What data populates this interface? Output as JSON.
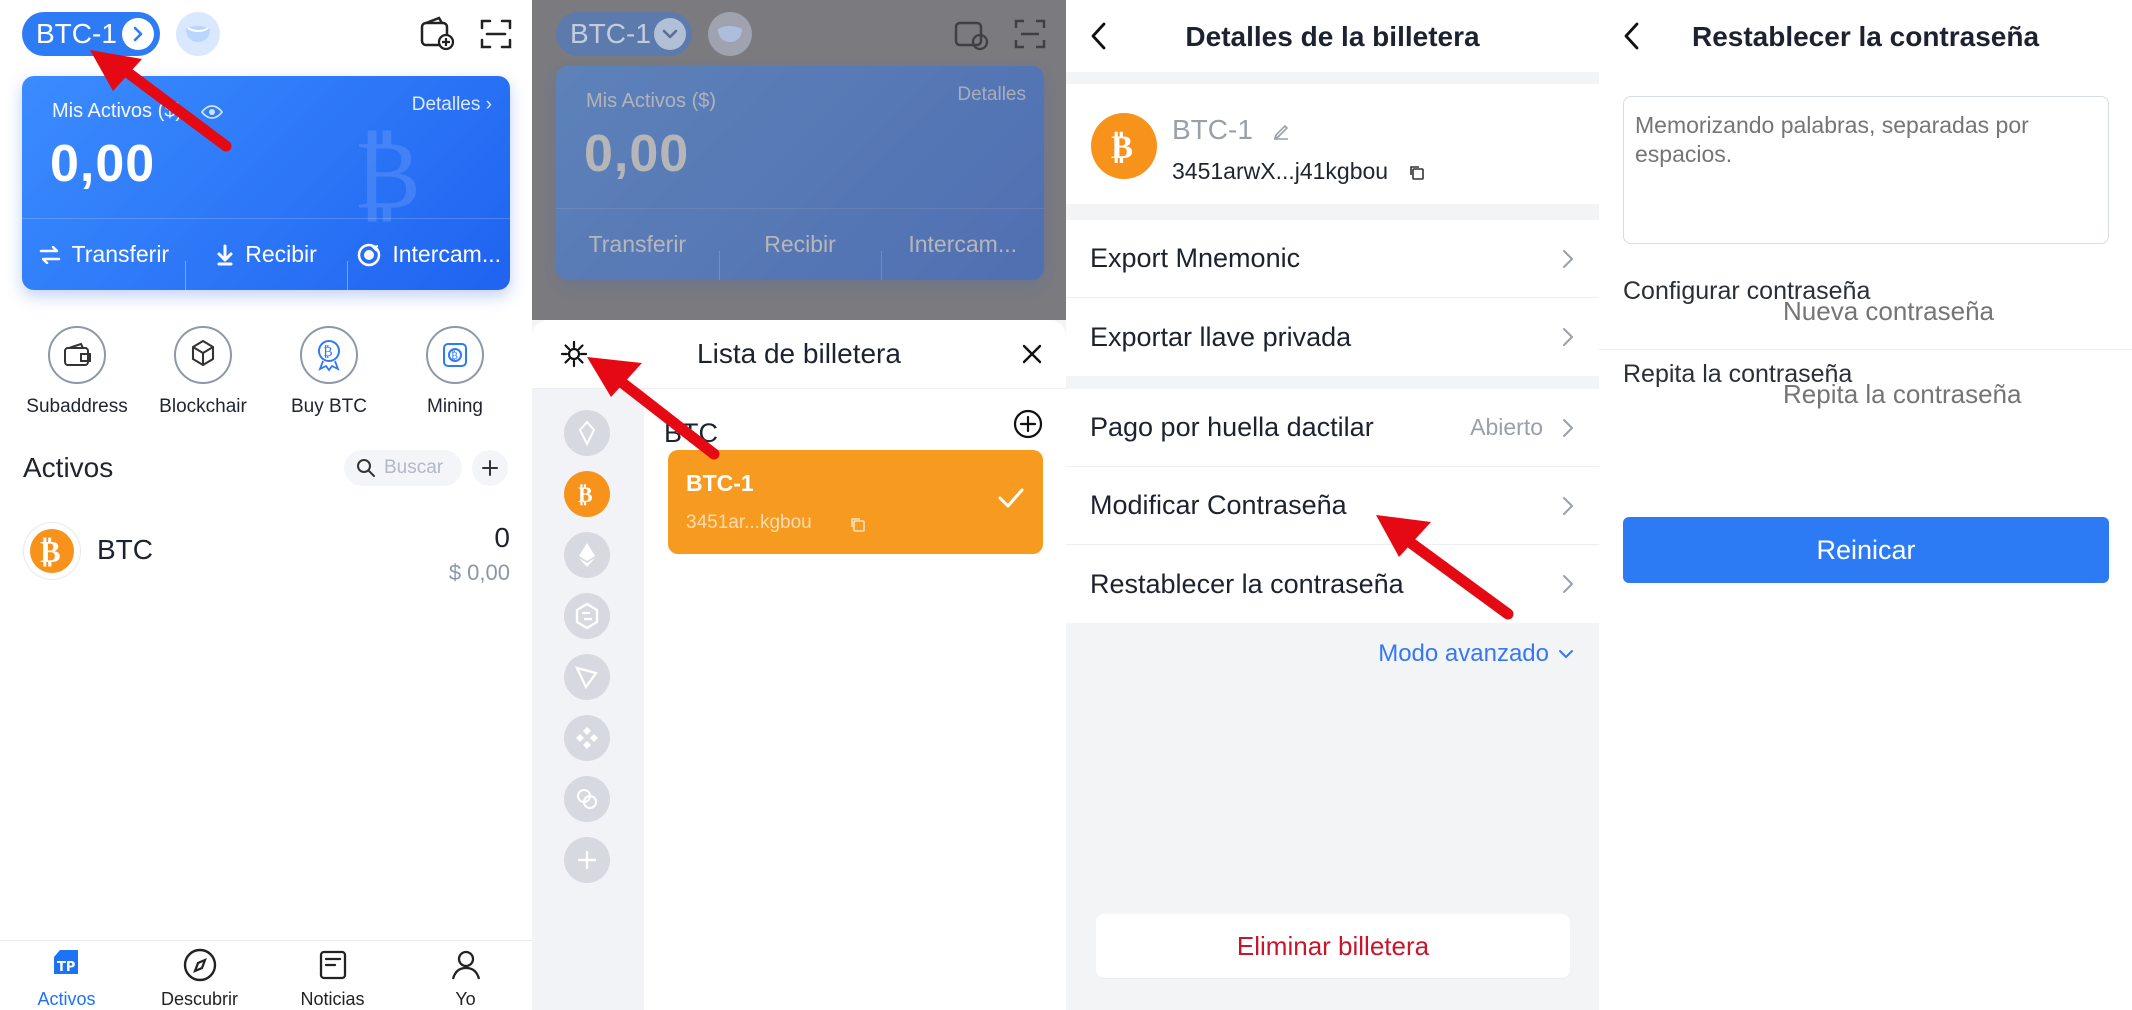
{
  "panel1": {
    "wallet_pill_label": "BTC-1",
    "assets_label": "Mis Activos ($)",
    "details_link": "Detalles",
    "assets_amount": "0,00",
    "actions": [
      {
        "label": "Transferir",
        "icon": "transfer-icon"
      },
      {
        "label": "Recibir",
        "icon": "receive-icon"
      },
      {
        "label": "Intercam...",
        "icon": "exchange-icon"
      }
    ],
    "quick_links": [
      {
        "label": "Subaddress",
        "icon": "wallet-icon"
      },
      {
        "label": "Blockchair",
        "icon": "cube-icon"
      },
      {
        "label": "Buy BTC",
        "icon": "bitcoin-medal-icon"
      },
      {
        "label": "Mining",
        "icon": "mining-icon"
      }
    ],
    "assets_title": "Activos",
    "search_placeholder": "Buscar",
    "asset_row": {
      "symbol": "BTC",
      "balance": "0",
      "fiat": "$ 0,00"
    },
    "bottom_nav": [
      {
        "label": "Activos",
        "icon": "tp-logo-icon",
        "active": true
      },
      {
        "label": "Descubrir",
        "icon": "compass-icon",
        "active": false
      },
      {
        "label": "Noticias",
        "icon": "news-icon",
        "active": false
      },
      {
        "label": "Yo",
        "icon": "user-icon",
        "active": false
      }
    ]
  },
  "panel2": {
    "sheet_title": "Lista de billetera",
    "chain_label": "BTC",
    "wallet_name": "BTC-1",
    "wallet_address": "3451ar...kgbou",
    "chain_icons": [
      "eos-icon",
      "bitcoin-icon",
      "ethereum-icon",
      "hexagon-icon",
      "tron-icon",
      "binance-icon",
      "cosmos-icon",
      "more-icon"
    ]
  },
  "panel3": {
    "title": "Detalles de la billetera",
    "wallet_name": "BTC-1",
    "wallet_address": "3451arwX...j41kgbou",
    "group1": [
      "Export Mnemonic",
      "Exportar llave privada"
    ],
    "group2": [
      {
        "label": "Pago por huella dactilar",
        "value": "Abierto"
      },
      {
        "label": "Modificar Contraseña",
        "value": ""
      },
      {
        "label": "Restablecer la contraseña",
        "value": ""
      }
    ],
    "advanced_mode": "Modo avanzado",
    "delete_wallet": "Eliminar billetera"
  },
  "panel4": {
    "title": "Restablecer la contraseña",
    "mnemonic_placeholder": "Memorizando palabras, separadas por espacios.",
    "set_password_label": "Configurar contraseña",
    "new_password_placeholder": "Nueva contraseña",
    "repeat_label": "Repita la contraseña",
    "repeat_placeholder": "Repita la contraseña",
    "reset_button": "Reinicar"
  },
  "colors": {
    "primary_blue": "#2E7BF6",
    "btc_orange": "#F7931A",
    "danger_red": "#C7162B",
    "arrow_red": "#E50914"
  }
}
